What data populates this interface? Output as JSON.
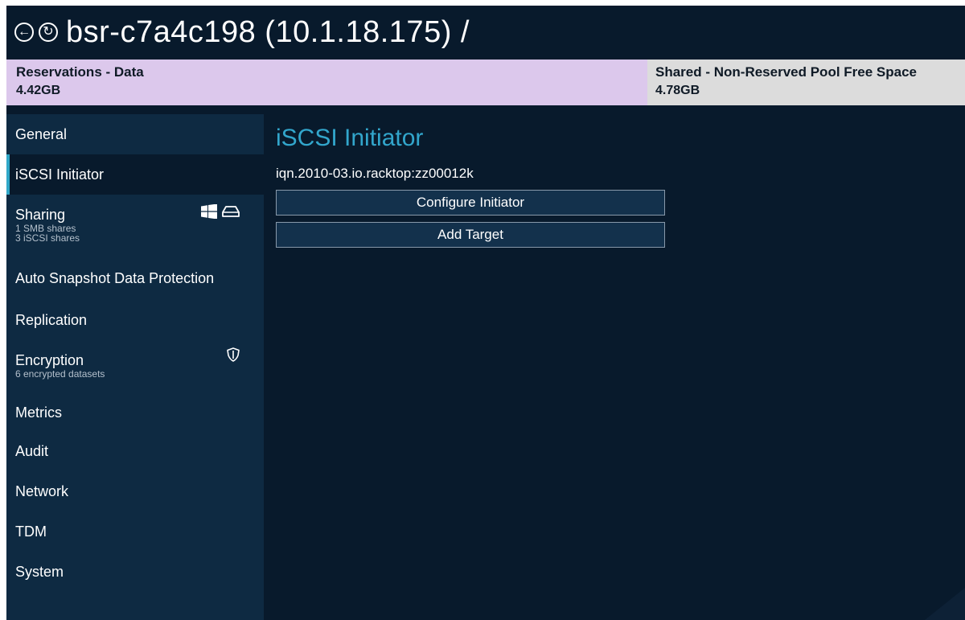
{
  "window": {
    "title": "bsr-c7a4c198 (10.1.18.175) /",
    "back_glyph": "←",
    "refresh_glyph": "↻"
  },
  "pool": {
    "segments": [
      {
        "name": "Reservations - Data",
        "value": "4.42GB",
        "color": "#dcc8ec"
      },
      {
        "name": "Shared - Non-Reserved Pool Free Space",
        "value": "4.78GB",
        "color": "#dcdcdc"
      }
    ]
  },
  "sidebar": {
    "items": [
      {
        "label": "General"
      },
      {
        "label": "iSCSI Initiator",
        "active": true
      },
      {
        "label": "Sharing",
        "sub1": "1 SMB shares",
        "sub2": "3 iSCSI shares",
        "icons": [
          "windows-icon",
          "drive-icon"
        ]
      },
      {
        "label": "Auto Snapshot Data Protection"
      },
      {
        "label": "Replication"
      },
      {
        "label": "Encryption",
        "sub1": "6 encrypted datasets",
        "icons": [
          "shield-icon"
        ]
      },
      {
        "label": "Metrics"
      },
      {
        "label": "Audit"
      },
      {
        "label": "Network"
      },
      {
        "label": "TDM"
      },
      {
        "label": "System"
      }
    ]
  },
  "main": {
    "title": "iSCSI Initiator",
    "iqn": "iqn.2010-03.io.racktop:zz00012k",
    "buttons": {
      "configure": "Configure Initiator",
      "add_target": "Add Target"
    }
  },
  "colors": {
    "background": "#081a2c",
    "sidebar": "#0e2a42",
    "accent": "#32a6cc",
    "button": "#13314c"
  }
}
